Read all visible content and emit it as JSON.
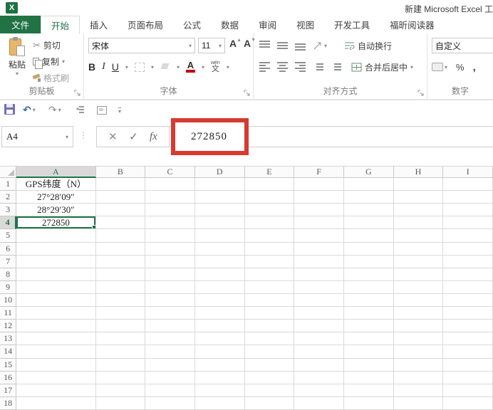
{
  "title_bar": {
    "app_title": "新建 Microsoft Excel 工"
  },
  "tab_bar": {
    "file_tab": "文件",
    "tabs": [
      {
        "label": "开始",
        "active": true
      },
      {
        "label": "插入",
        "active": false
      },
      {
        "label": "页面布局",
        "active": false
      },
      {
        "label": "公式",
        "active": false
      },
      {
        "label": "数据",
        "active": false
      },
      {
        "label": "审阅",
        "active": false
      },
      {
        "label": "视图",
        "active": false
      },
      {
        "label": "开发工具",
        "active": false
      },
      {
        "label": "福昕阅读器",
        "active": false
      }
    ]
  },
  "ribbon": {
    "clipboard": {
      "paste": "粘贴",
      "cut": "剪切",
      "copy": "复制",
      "format_painter": "格式刷",
      "label": "剪贴板"
    },
    "font": {
      "name": "宋体",
      "size": "11",
      "bold": "B",
      "italic": "I",
      "underline": "U",
      "grow_font": "A",
      "shrink_font": "A",
      "font_color": "A",
      "phonetic_top": "wén",
      "phonetic_bottom": "文",
      "label": "字体"
    },
    "alignment": {
      "wrap_text": "自动换行",
      "merge_center": "合并后居中",
      "label": "对齐方式"
    },
    "number": {
      "format": "自定义",
      "percent": "%",
      "comma": ",",
      "label": "数字"
    }
  },
  "formula_bar": {
    "name_box": "A4",
    "cancel": "✕",
    "enter": "✓",
    "fx": "fx",
    "value": "272850"
  },
  "grid": {
    "columns": [
      "A",
      "B",
      "C",
      "D",
      "E",
      "F",
      "G",
      "H",
      "I"
    ],
    "selected_column": "A",
    "rows": [
      "1",
      "2",
      "3",
      "4",
      "5",
      "6",
      "7",
      "8",
      "9",
      "10",
      "11",
      "12",
      "13",
      "14",
      "15",
      "16",
      "17",
      "18"
    ],
    "selected_row": "4",
    "active_cell": "A4",
    "cells": {
      "A1": "GPS纬度（N）",
      "A2": "27°28′09″",
      "A3": "28°29′30″",
      "A4": "272850"
    }
  },
  "icons": {
    "dropdown": "▾",
    "undo": "↶",
    "redo": "↷",
    "dots": "⋮",
    "scissors": "✂"
  },
  "colors": {
    "excel_green": "#217346",
    "annotation_red": "#d83931"
  }
}
